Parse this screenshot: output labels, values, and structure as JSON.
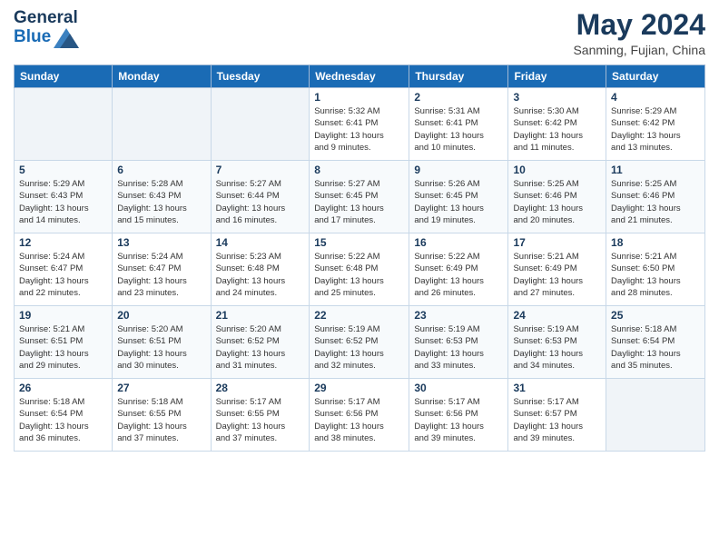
{
  "header": {
    "logo_line1": "General",
    "logo_line2": "Blue",
    "month": "May 2024",
    "location": "Sanming, Fujian, China"
  },
  "days_of_week": [
    "Sunday",
    "Monday",
    "Tuesday",
    "Wednesday",
    "Thursday",
    "Friday",
    "Saturday"
  ],
  "weeks": [
    [
      {
        "day": "",
        "info": ""
      },
      {
        "day": "",
        "info": ""
      },
      {
        "day": "",
        "info": ""
      },
      {
        "day": "1",
        "info": "Sunrise: 5:32 AM\nSunset: 6:41 PM\nDaylight: 13 hours\nand 9 minutes."
      },
      {
        "day": "2",
        "info": "Sunrise: 5:31 AM\nSunset: 6:41 PM\nDaylight: 13 hours\nand 10 minutes."
      },
      {
        "day": "3",
        "info": "Sunrise: 5:30 AM\nSunset: 6:42 PM\nDaylight: 13 hours\nand 11 minutes."
      },
      {
        "day": "4",
        "info": "Sunrise: 5:29 AM\nSunset: 6:42 PM\nDaylight: 13 hours\nand 13 minutes."
      }
    ],
    [
      {
        "day": "5",
        "info": "Sunrise: 5:29 AM\nSunset: 6:43 PM\nDaylight: 13 hours\nand 14 minutes."
      },
      {
        "day": "6",
        "info": "Sunrise: 5:28 AM\nSunset: 6:43 PM\nDaylight: 13 hours\nand 15 minutes."
      },
      {
        "day": "7",
        "info": "Sunrise: 5:27 AM\nSunset: 6:44 PM\nDaylight: 13 hours\nand 16 minutes."
      },
      {
        "day": "8",
        "info": "Sunrise: 5:27 AM\nSunset: 6:45 PM\nDaylight: 13 hours\nand 17 minutes."
      },
      {
        "day": "9",
        "info": "Sunrise: 5:26 AM\nSunset: 6:45 PM\nDaylight: 13 hours\nand 19 minutes."
      },
      {
        "day": "10",
        "info": "Sunrise: 5:25 AM\nSunset: 6:46 PM\nDaylight: 13 hours\nand 20 minutes."
      },
      {
        "day": "11",
        "info": "Sunrise: 5:25 AM\nSunset: 6:46 PM\nDaylight: 13 hours\nand 21 minutes."
      }
    ],
    [
      {
        "day": "12",
        "info": "Sunrise: 5:24 AM\nSunset: 6:47 PM\nDaylight: 13 hours\nand 22 minutes."
      },
      {
        "day": "13",
        "info": "Sunrise: 5:24 AM\nSunset: 6:47 PM\nDaylight: 13 hours\nand 23 minutes."
      },
      {
        "day": "14",
        "info": "Sunrise: 5:23 AM\nSunset: 6:48 PM\nDaylight: 13 hours\nand 24 minutes."
      },
      {
        "day": "15",
        "info": "Sunrise: 5:22 AM\nSunset: 6:48 PM\nDaylight: 13 hours\nand 25 minutes."
      },
      {
        "day": "16",
        "info": "Sunrise: 5:22 AM\nSunset: 6:49 PM\nDaylight: 13 hours\nand 26 minutes."
      },
      {
        "day": "17",
        "info": "Sunrise: 5:21 AM\nSunset: 6:49 PM\nDaylight: 13 hours\nand 27 minutes."
      },
      {
        "day": "18",
        "info": "Sunrise: 5:21 AM\nSunset: 6:50 PM\nDaylight: 13 hours\nand 28 minutes."
      }
    ],
    [
      {
        "day": "19",
        "info": "Sunrise: 5:21 AM\nSunset: 6:51 PM\nDaylight: 13 hours\nand 29 minutes."
      },
      {
        "day": "20",
        "info": "Sunrise: 5:20 AM\nSunset: 6:51 PM\nDaylight: 13 hours\nand 30 minutes."
      },
      {
        "day": "21",
        "info": "Sunrise: 5:20 AM\nSunset: 6:52 PM\nDaylight: 13 hours\nand 31 minutes."
      },
      {
        "day": "22",
        "info": "Sunrise: 5:19 AM\nSunset: 6:52 PM\nDaylight: 13 hours\nand 32 minutes."
      },
      {
        "day": "23",
        "info": "Sunrise: 5:19 AM\nSunset: 6:53 PM\nDaylight: 13 hours\nand 33 minutes."
      },
      {
        "day": "24",
        "info": "Sunrise: 5:19 AM\nSunset: 6:53 PM\nDaylight: 13 hours\nand 34 minutes."
      },
      {
        "day": "25",
        "info": "Sunrise: 5:18 AM\nSunset: 6:54 PM\nDaylight: 13 hours\nand 35 minutes."
      }
    ],
    [
      {
        "day": "26",
        "info": "Sunrise: 5:18 AM\nSunset: 6:54 PM\nDaylight: 13 hours\nand 36 minutes."
      },
      {
        "day": "27",
        "info": "Sunrise: 5:18 AM\nSunset: 6:55 PM\nDaylight: 13 hours\nand 37 minutes."
      },
      {
        "day": "28",
        "info": "Sunrise: 5:17 AM\nSunset: 6:55 PM\nDaylight: 13 hours\nand 37 minutes."
      },
      {
        "day": "29",
        "info": "Sunrise: 5:17 AM\nSunset: 6:56 PM\nDaylight: 13 hours\nand 38 minutes."
      },
      {
        "day": "30",
        "info": "Sunrise: 5:17 AM\nSunset: 6:56 PM\nDaylight: 13 hours\nand 39 minutes."
      },
      {
        "day": "31",
        "info": "Sunrise: 5:17 AM\nSunset: 6:57 PM\nDaylight: 13 hours\nand 39 minutes."
      },
      {
        "day": "",
        "info": ""
      }
    ]
  ]
}
